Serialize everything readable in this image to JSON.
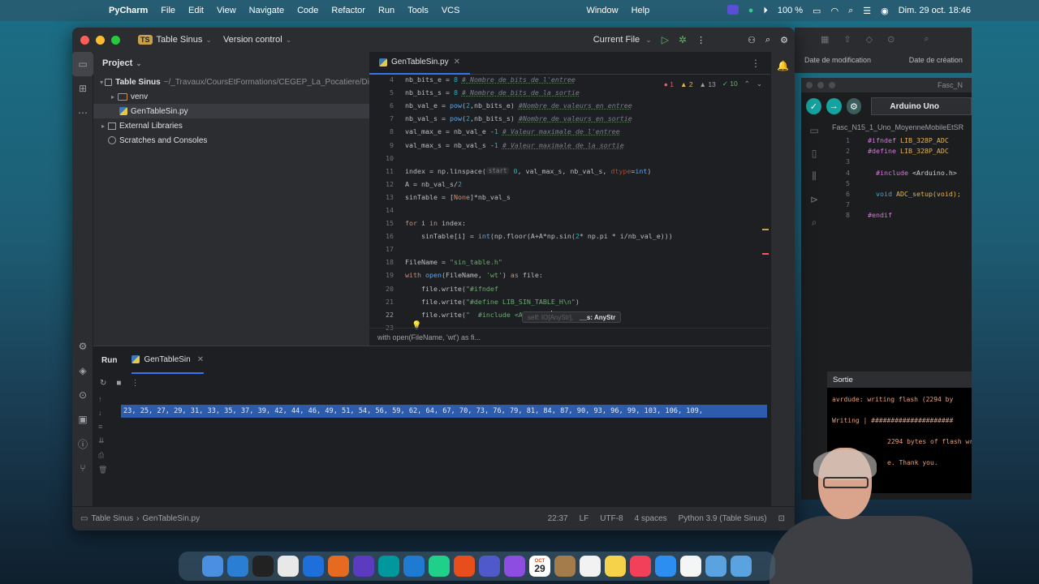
{
  "menubar": {
    "app": "PyCharm",
    "items": [
      "File",
      "Edit",
      "View",
      "Navigate",
      "Code",
      "Refactor",
      "Run",
      "Tools",
      "VCS"
    ],
    "window": "Window",
    "help": "Help",
    "battery": "100 %",
    "datetime": "Dim. 29 oct. 18:46"
  },
  "ide": {
    "project_badge": "TS",
    "project_name": "Table Sinus",
    "version_control": "Version control",
    "run_config": "Current File",
    "project_panel_title": "Project",
    "tree": {
      "root": "Table Sinus",
      "root_path": "~/_Travaux/CoursEtFormations/CEGEP_La_Pocatiere/Di",
      "venv": "venv",
      "file": "GenTableSin.py",
      "external": "External Libraries",
      "scratches": "Scratches and Consoles"
    },
    "editor_tab": "GenTableSin.py",
    "inspections": {
      "errors": "1",
      "warnings": "2",
      "weak": "13",
      "typos": "10"
    },
    "code_lines": [
      {
        "n": "4",
        "parts": [
          [
            "plain",
            "nb_bits_e = "
          ],
          [
            "num",
            "8"
          ],
          [
            "plain",
            " "
          ],
          [
            "cmt",
            "# Nombre de bits de l'entree"
          ]
        ]
      },
      {
        "n": "5",
        "parts": [
          [
            "plain",
            "nb_bits_s = "
          ],
          [
            "num",
            "8"
          ],
          [
            "plain",
            " "
          ],
          [
            "cmt",
            "# Nombre de bits de la sortie"
          ]
        ]
      },
      {
        "n": "6",
        "parts": [
          [
            "plain",
            "nb_val_e = "
          ],
          [
            "fn",
            "pow"
          ],
          [
            "plain",
            "("
          ],
          [
            "num",
            "2"
          ],
          [
            "plain",
            ",nb_bits_e) "
          ],
          [
            "cmt",
            "#Nombre de valeurs en entree"
          ]
        ]
      },
      {
        "n": "7",
        "parts": [
          [
            "plain",
            "nb_val_s = "
          ],
          [
            "fn",
            "pow"
          ],
          [
            "plain",
            "("
          ],
          [
            "num",
            "2"
          ],
          [
            "plain",
            ",nb_bits_s) "
          ],
          [
            "cmt",
            "#Nombre de valeurs en sortie"
          ]
        ]
      },
      {
        "n": "8",
        "parts": [
          [
            "plain",
            "val_max_e = nb_val_e -"
          ],
          [
            "num",
            "1"
          ],
          [
            "plain",
            " "
          ],
          [
            "cmt",
            "# Valeur maximale de l'entree"
          ]
        ]
      },
      {
        "n": "9",
        "parts": [
          [
            "plain",
            "val_max_s = nb_val_s -"
          ],
          [
            "num",
            "1"
          ],
          [
            "plain",
            " "
          ],
          [
            "cmt",
            "# Valeur maximale de la sortie"
          ]
        ]
      },
      {
        "n": "10",
        "parts": []
      },
      {
        "n": "11",
        "parts": [
          [
            "plain",
            "index = np.linspace("
          ],
          [
            "hint",
            "start"
          ],
          [
            "plain",
            " "
          ],
          [
            "num",
            "0"
          ],
          [
            "plain",
            ", val_max_s, nb_val_s, "
          ],
          [
            "prm",
            "dtype"
          ],
          [
            "plain",
            "="
          ],
          [
            "fn",
            "int"
          ],
          [
            "plain",
            ")"
          ]
        ]
      },
      {
        "n": "12",
        "parts": [
          [
            "plain",
            "A = nb_val_s/"
          ],
          [
            "num",
            "2"
          ]
        ]
      },
      {
        "n": "13",
        "parts": [
          [
            "plain",
            "sinTable = ["
          ],
          [
            "kw",
            "None"
          ],
          [
            "plain",
            "]*nb_val_s"
          ]
        ]
      },
      {
        "n": "14",
        "parts": []
      },
      {
        "n": "15",
        "parts": [
          [
            "kw",
            "for"
          ],
          [
            "plain",
            " i "
          ],
          [
            "kw",
            "in"
          ],
          [
            "plain",
            " index:"
          ]
        ]
      },
      {
        "n": "16",
        "parts": [
          [
            "plain",
            "    sinTable[i] = "
          ],
          [
            "fn",
            "int"
          ],
          [
            "plain",
            "(np.floor(A+A*np.sin("
          ],
          [
            "num",
            "2"
          ],
          [
            "plain",
            "* np.pi * i/nb_val_e)))"
          ]
        ]
      },
      {
        "n": "17",
        "parts": []
      },
      {
        "n": "18",
        "parts": [
          [
            "plain",
            "FileName = "
          ],
          [
            "str",
            "\"sin_table.h\""
          ]
        ]
      },
      {
        "n": "19",
        "parts": [
          [
            "kw",
            "with"
          ],
          [
            "plain",
            " "
          ],
          [
            "fn",
            "open"
          ],
          [
            "plain",
            "(FileName, "
          ],
          [
            "str",
            "'wt'"
          ],
          [
            "plain",
            ") "
          ],
          [
            "kw",
            "as"
          ],
          [
            "plain",
            " file:"
          ]
        ]
      },
      {
        "n": "20",
        "parts": [
          [
            "plain",
            "    file.write("
          ],
          [
            "str",
            "\"#ifndef"
          ]
        ]
      },
      {
        "n": "21",
        "parts": [
          [
            "plain",
            "    file.write("
          ],
          [
            "str",
            "\"#define LIB_SIN_TABLE_H\\n\""
          ],
          [
            "plain",
            ")"
          ]
        ]
      },
      {
        "n": "22",
        "parts": [
          [
            "plain",
            "    file.write("
          ],
          [
            "str",
            "\"  #include <Arduino."
          ],
          [
            "caret",
            ""
          ],
          [
            "str",
            "\""
          ],
          [
            "plain",
            ")"
          ]
        ]
      },
      {
        "n": "23",
        "parts": []
      }
    ],
    "param_popup": {
      "dim": "self: IO[AnyStr],",
      "bold": "__s: AnyStr"
    },
    "editor_breadcrumb": "with open(FileName, 'wt') as fi...",
    "run_title": "Run",
    "run_tab": "GenTableSin",
    "run_output": "23, 25, 27, 29, 31, 33, 35, 37, 39, 42, 44, 46, 49, 51, 54, 56, 59, 62, 64, 67, 70, 73, 76, 79, 81, 84, 87, 90, 93, 96, 99, 103, 106, 109,",
    "status": {
      "crumb_project": "Table Sinus",
      "crumb_file": "GenTableSin.py",
      "position": "22:37",
      "line_sep": "LF",
      "encoding": "UTF-8",
      "indent": "4 spaces",
      "interpreter": "Python 3.9 (Table Sinus)"
    }
  },
  "finder": {
    "col_modified": "Date de modification",
    "col_created": "Date de création"
  },
  "arduino": {
    "window_title": "Fasc_N",
    "board": "Arduino Uno",
    "file": "Fasc_N15_1_Uno_MoyenneMobileEtSR",
    "code": [
      {
        "n": "1",
        "a": "#ifndef",
        "b": " LIB_328P_ADC"
      },
      {
        "n": "2",
        "a": "#define",
        "b": " LIB_328P_ADC"
      },
      {
        "n": "3",
        "a": "",
        "b": ""
      },
      {
        "n": "4",
        "a": "  #include",
        "b": " <Arduino.h>"
      },
      {
        "n": "5",
        "a": "",
        "b": ""
      },
      {
        "n": "6",
        "a": "  void",
        "b": " ADC_setup(void);"
      },
      {
        "n": "7",
        "a": "",
        "b": ""
      },
      {
        "n": "8",
        "a": "#endif",
        "b": ""
      }
    ],
    "output_title": "Sortie",
    "output_lines": [
      "avrdude: writing flash (2294 by",
      "Writing | #####################",
      "2294 bytes of flash wr",
      "e.  Thank you."
    ]
  },
  "dock": {
    "calendar_month": "OCT",
    "calendar_day": "29",
    "apps": [
      "Finder",
      "Safari-like",
      "Terminal",
      "Chrome",
      "Browser",
      "Firefox",
      "Rider",
      "Arduino",
      "VS Code",
      "PyCharm",
      "Office",
      "Teams",
      "Messenger",
      "Calendar",
      "Notes-brown",
      "Reminders",
      "Notes",
      "Music",
      "App Store",
      "Script",
      "Folder",
      "Files"
    ]
  }
}
